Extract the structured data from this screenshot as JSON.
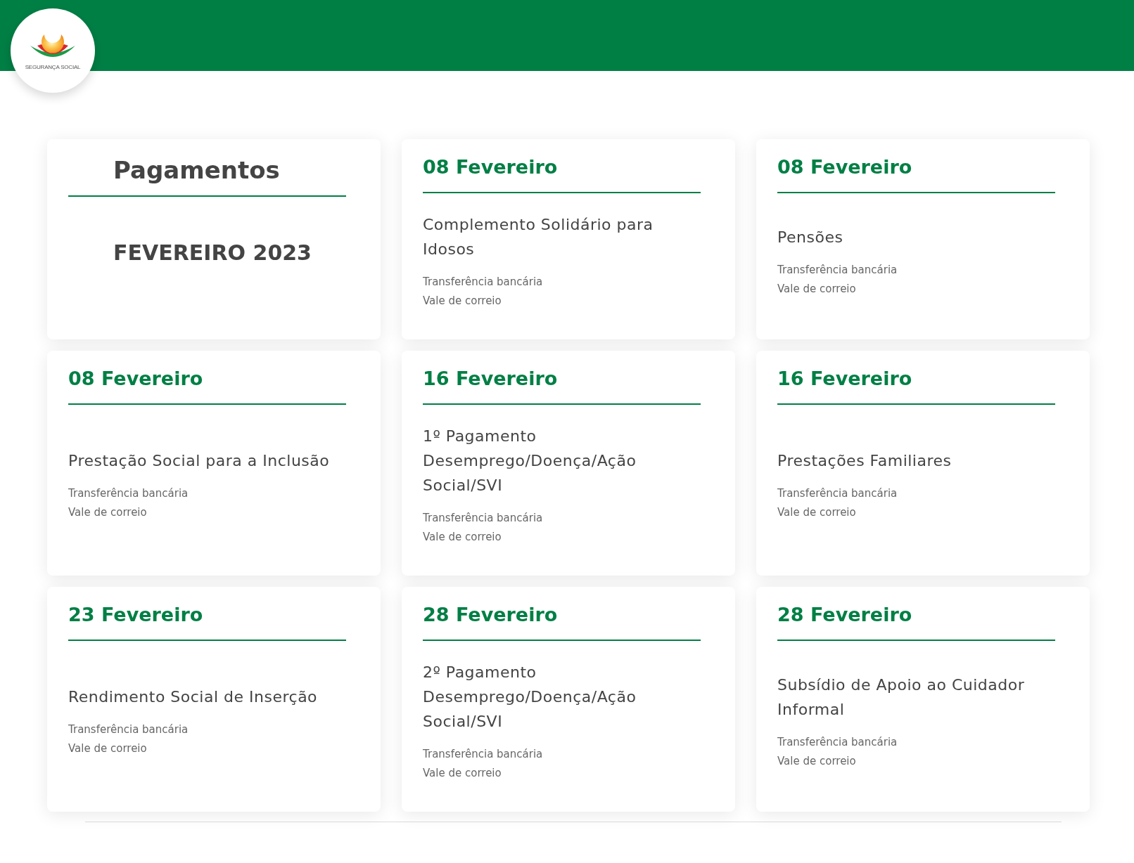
{
  "header": {
    "logo_text": "SEGURANÇA SOCIAL"
  },
  "cards": [
    {
      "kind": "title",
      "heading": "Pagamentos",
      "month": "FEVEREIRO 2023"
    },
    {
      "kind": "payment",
      "date": "08 Fevereiro",
      "benefit": "Complemento Solidário para Idosos",
      "methods": [
        "Transferência bancária",
        "Vale de correio"
      ]
    },
    {
      "kind": "payment",
      "date": "08 Fevereiro",
      "benefit": "Pensões",
      "methods": [
        "Transferência bancária",
        "Vale de correio"
      ]
    },
    {
      "kind": "payment",
      "date": "08 Fevereiro",
      "benefit": "Prestação Social para a Inclusão",
      "methods": [
        "Transferência bancária",
        "Vale de correio"
      ]
    },
    {
      "kind": "payment",
      "date": "16 Fevereiro",
      "benefit": "1º Pagamento Desemprego/Doença/Ação Social/SVI",
      "methods": [
        "Transferência bancária",
        "Vale de correio"
      ]
    },
    {
      "kind": "payment",
      "date": "16 Fevereiro",
      "benefit": "Prestações Familiares",
      "methods": [
        "Transferência bancária",
        "Vale de correio"
      ]
    },
    {
      "kind": "payment",
      "date": "23 Fevereiro",
      "benefit": "Rendimento Social de Inserção",
      "methods": [
        "Transferência bancária",
        "Vale de correio"
      ]
    },
    {
      "kind": "payment",
      "date": "28 Fevereiro",
      "benefit": "2º Pagamento Desemprego/Doença/Ação Social/SVI",
      "methods": [
        "Transferência bancária",
        "Vale de correio"
      ]
    },
    {
      "kind": "payment",
      "date": "28 Fevereiro",
      "benefit": "Subsídio de Apoio ao Cuidador Informal",
      "methods": [
        "Transferência bancária",
        "Vale de correio"
      ]
    }
  ]
}
